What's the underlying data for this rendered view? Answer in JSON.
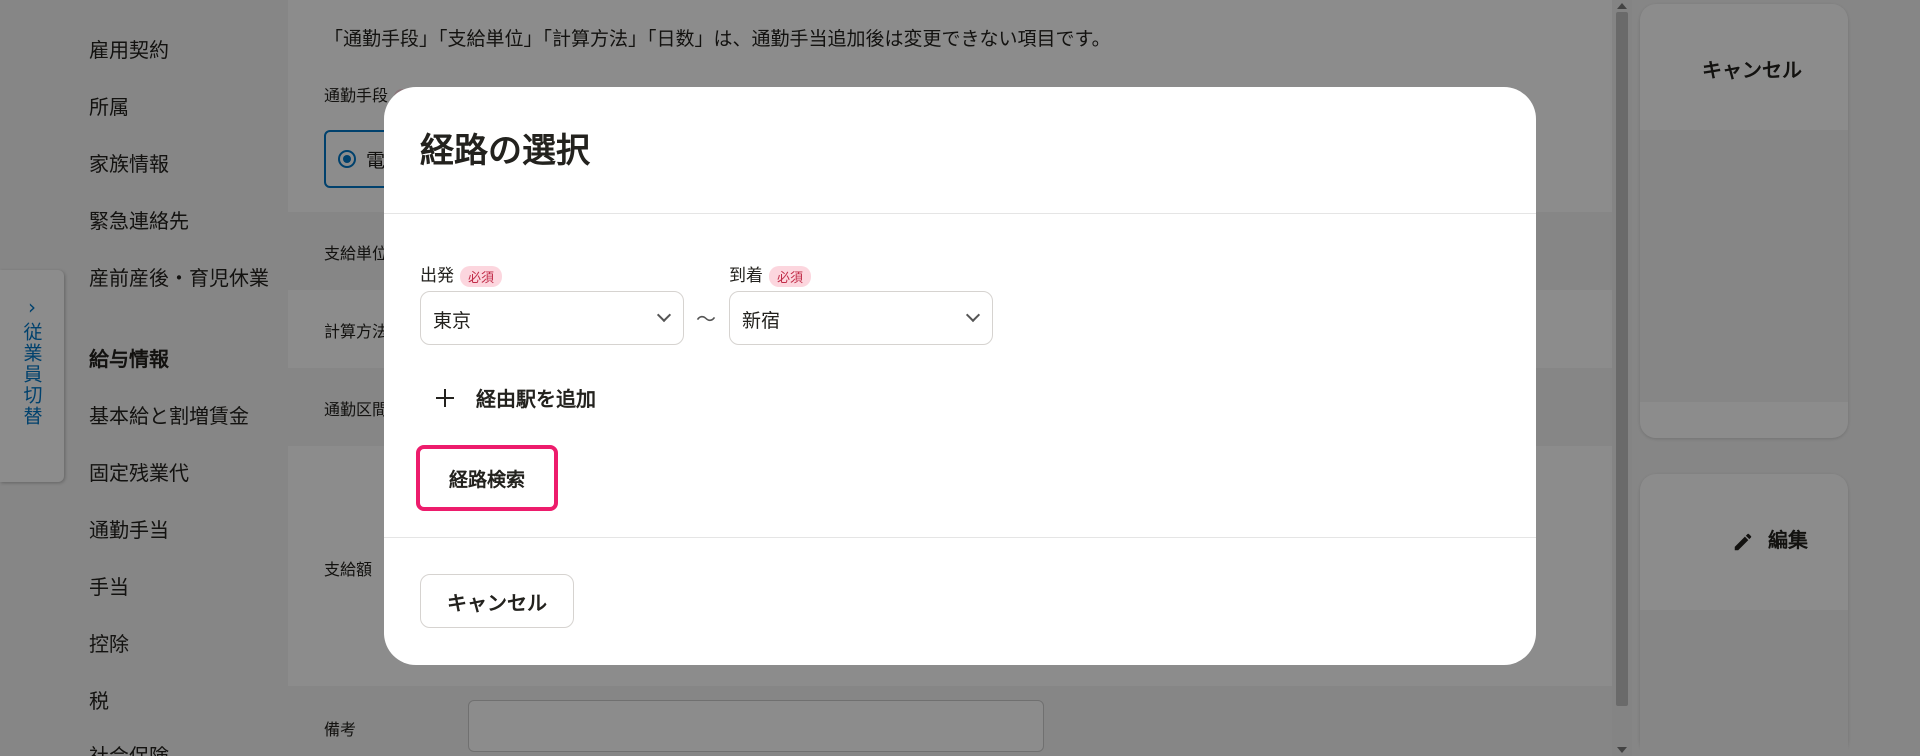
{
  "sidebar": {
    "items": [
      {
        "label": "雇用契約"
      },
      {
        "label": "所属"
      },
      {
        "label": "家族情報"
      },
      {
        "label": "緊急連絡先"
      },
      {
        "label": "産前産後・育児休業"
      }
    ],
    "salary_heading": "給与情報",
    "salary_items": [
      {
        "label": "基本給と割増賃金"
      },
      {
        "label": "固定残業代"
      },
      {
        "label": "通勤手当"
      },
      {
        "label": "手当"
      },
      {
        "label": "控除"
      },
      {
        "label": "税"
      },
      {
        "label": "社会保険"
      }
    ],
    "switch_tab": {
      "chevron": "›",
      "label": "従業員切替"
    }
  },
  "background_form": {
    "notice": "「通勤手段」「支給単位」「計算方法」「日数」は、通勤手当追加後は変更できない項目です。",
    "labels": {
      "commute_method": "通勤手段",
      "pay_unit": "支給単位",
      "calc_method": "計算方法",
      "commute_section": "通勤区間",
      "amount": "支給額",
      "memo": "備考"
    },
    "radio_partial": "電"
  },
  "right_panel": {
    "cancel_label": "キャンセル",
    "edit_label": "編集"
  },
  "modal": {
    "title": "経路の選択",
    "departure": {
      "label": "出発",
      "required": "必須",
      "value": "東京"
    },
    "arrival": {
      "label": "到着",
      "required": "必須",
      "value": "新宿"
    },
    "separator": "〜",
    "add_via_label": "経由駅を追加",
    "search_label": "経路検索",
    "cancel_label": "キャンセル"
  },
  "colors": {
    "accent_blue": "#0077c7",
    "highlight_pink": "#ed1c6c",
    "required_bg": "#fcd6de",
    "required_text": "#c12c48"
  }
}
